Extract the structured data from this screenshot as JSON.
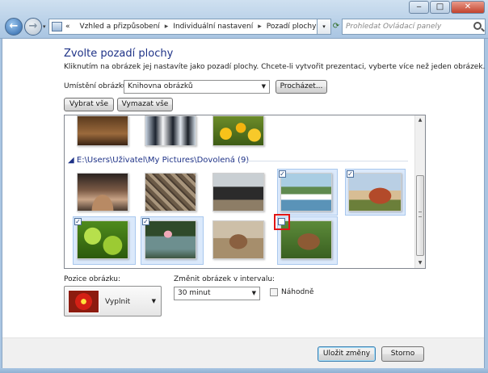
{
  "window": {
    "minimize": "‒",
    "maximize": "□",
    "close": "✕"
  },
  "nav": {
    "back": "←",
    "forward": "→",
    "recent": "▾"
  },
  "breadcrumb": {
    "chevron": "«",
    "items": [
      "Vzhled a přizpůsobení",
      "Individuální nastavení",
      "Pozadí plochy"
    ],
    "separator": "▸"
  },
  "search": {
    "placeholder": "Prohledat Ovládací panely"
  },
  "page": {
    "title": "Zvolte pozadí plochy",
    "subtitle": "Kliknutím na obrázek jej nastavíte jako pozadí plochy. Chcete-li vytvořit prezentaci, vyberte více než jeden obrázek."
  },
  "location": {
    "label": "Umístění obrázku:",
    "value": "Knihovna obrázků",
    "browse": "Procházet..."
  },
  "selection": {
    "select_all": "Vybrat vše",
    "clear_all": "Vymazat vše"
  },
  "gallery": {
    "group_title": "E:\\Users\\Uživatel\\My Pictures\\Dovolená (9)",
    "checkmark": "✓"
  },
  "position": {
    "label": "Pozice obrázku:",
    "value": "Vyplnit"
  },
  "interval": {
    "label": "Změnit obrázek v intervalu:",
    "value": "30 minut"
  },
  "shuffle": {
    "label": "Náhodně"
  },
  "footer": {
    "save": "Uložit změny",
    "cancel": "Storno"
  },
  "colors": {
    "accent": "#1e3287",
    "selection": "#dbe9fb",
    "highlight": "#e01515"
  }
}
